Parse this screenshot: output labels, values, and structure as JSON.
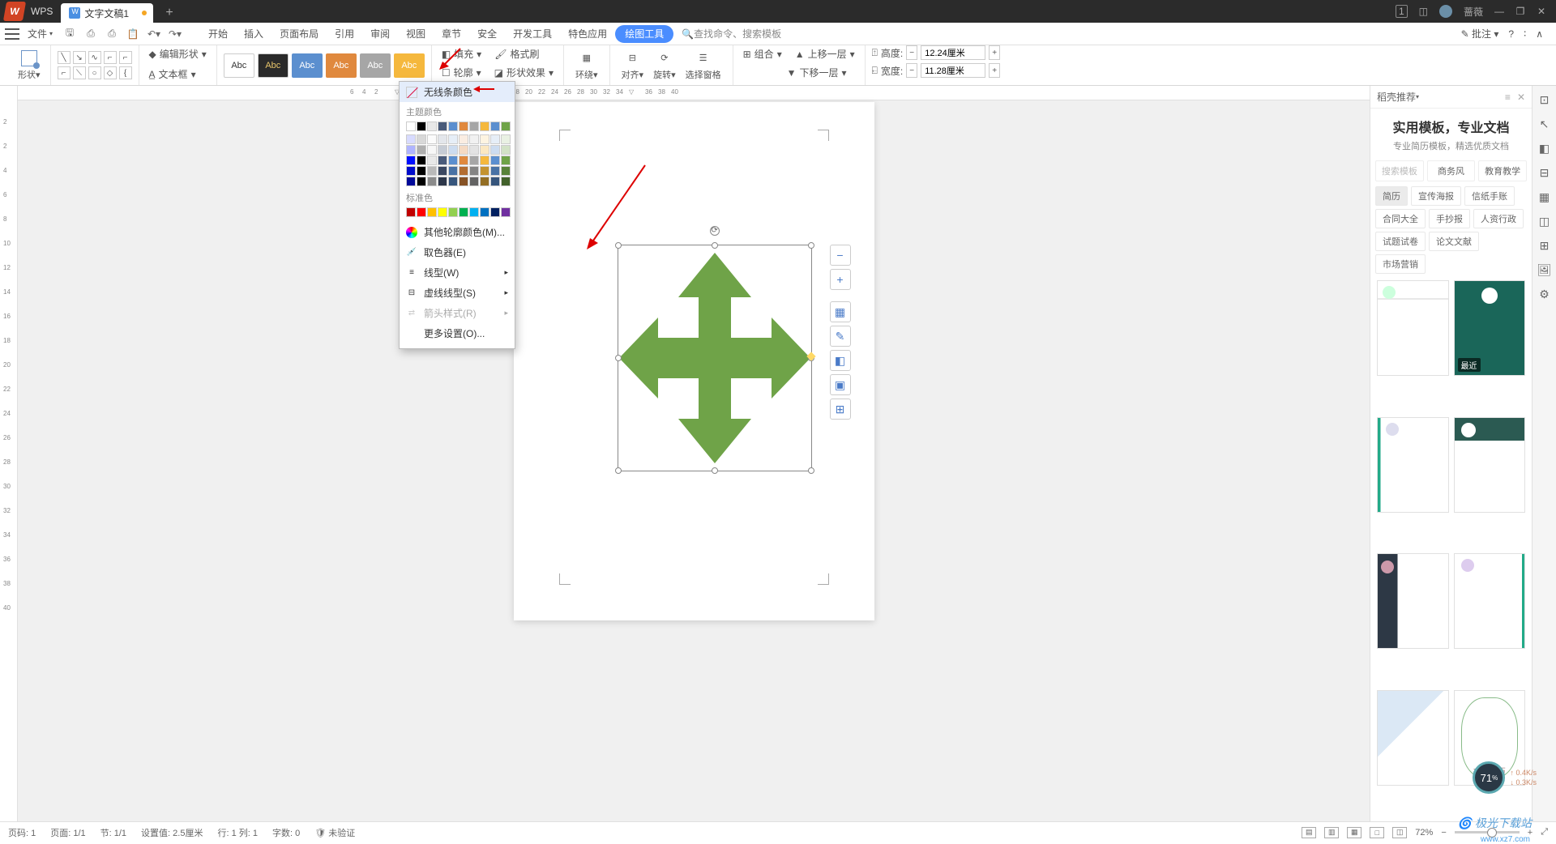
{
  "titlebar": {
    "app": "WPS",
    "tab_name": "文字文稿1",
    "user": "蔷薇",
    "badge": "1"
  },
  "menubar": {
    "file": "文件",
    "items": [
      "开始",
      "插入",
      "页面布局",
      "引用",
      "审阅",
      "视图",
      "章节",
      "安全",
      "开发工具",
      "特色应用",
      "绘图工具"
    ],
    "active": "绘图工具",
    "search_ph": "查找命令、搜索模板",
    "annotate": "批注"
  },
  "ribbon": {
    "shape": "形状",
    "edit_shape": "编辑形状",
    "textbox": "文本框",
    "preset_label": "Abc",
    "fill": "填充",
    "outline": "轮廓",
    "format_painter": "格式刷",
    "shape_effect": "形状效果",
    "wrap": "环绕",
    "align": "对齐",
    "rotate": "旋转",
    "selection_pane": "选择窗格",
    "group": "组合",
    "bring_forward": "上移一层",
    "send_backward": "下移一层",
    "height": "高度:",
    "height_v": "12.24厘米",
    "width": "宽度:",
    "width_v": "11.28厘米"
  },
  "dropdown": {
    "no_line": "无线条颜色",
    "theme": "主题颜色",
    "standard": "标准色",
    "more_colors": "其他轮廓颜色(M)...",
    "eyedropper": "取色器(E)",
    "line_style": "线型(W)",
    "dash_style": "虚线线型(S)",
    "arrow_style": "箭头样式(R)",
    "more_settings": "更多设置(O)..."
  },
  "float_btns": [
    "−",
    "+"
  ],
  "right": {
    "header": "稻壳推荐",
    "title": "实用模板，专业文档",
    "subtitle": "专业简历模板，精选优质文档",
    "tabs": [
      "搜索模板",
      "商务风",
      "教育教学"
    ],
    "tags": [
      "简历",
      "宣传海报",
      "信纸手账",
      "合同大全",
      "手抄报",
      "人资行政",
      "试题试卷",
      "论文文献",
      "市场营销"
    ],
    "badge": "最近"
  },
  "statusbar": {
    "page": "页码: 1",
    "pages": "页面: 1/1",
    "section": "节: 1/1",
    "pos": "设置值: 2.5厘米",
    "rowcol": "行: 1  列: 1",
    "chars": "字数: 0",
    "review": "未验证",
    "zoom": "72%"
  },
  "widget": {
    "pct": "71",
    "unit": "%",
    "up": "0.4K/s",
    "down": "0.3K/s"
  },
  "watermark": "极光下载站",
  "watermark2": "www.xz7.com"
}
